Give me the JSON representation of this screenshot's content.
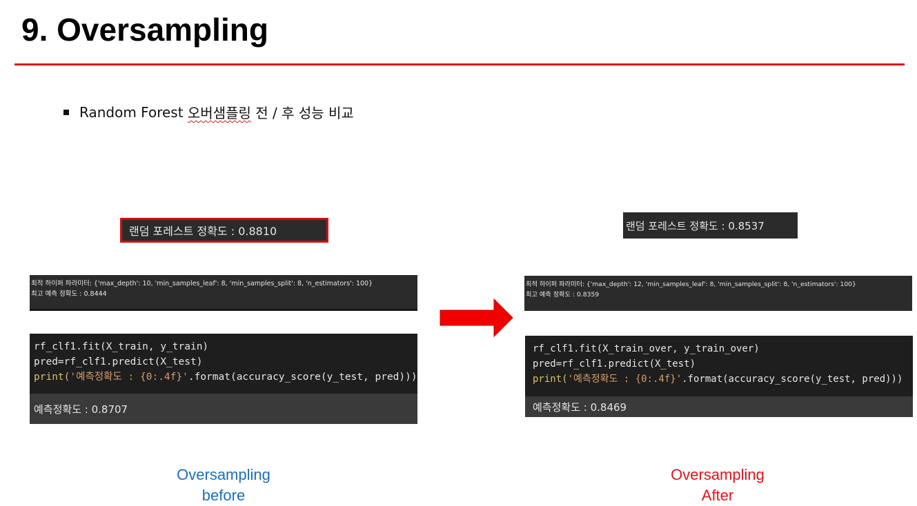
{
  "slide": {
    "title": "9. Oversampling",
    "bullet": {
      "prefix": "Random Forest ",
      "underlined": "오버샘플링",
      "suffix": " 전 / 후 성능 비교"
    }
  },
  "before": {
    "accuracy_text": "랜덤 포레스트 정확도 : 0.8810",
    "params_line1": "최적 하이퍼 파라미터:  {'max_depth': 10, 'min_samples_leaf': 8, 'min_samples_split': 8, 'n_estimators': 100}",
    "params_line2": "최고 예측 정확도 : 0.8444",
    "code_line1": "rf_clf1.fit(X_train, y_train)",
    "code_line2": "pred=rf_clf1.predict(X_test)",
    "code_line3_kw": "print(",
    "code_line3_str": "'예측정확도 : {0:.4f}'",
    "code_line3_rest": ".format(accuracy_score(y_test, pred)))",
    "output": "예측정확도 : 0.8707",
    "caption_line1": "Oversampling",
    "caption_line2": "before"
  },
  "after": {
    "accuracy_text": "랜덤 포레스트 정확도 : 0.8537",
    "params_line1": "최적 하이퍼 파라미터:  {'max_depth': 12, 'min_samples_leaf': 8, 'min_samples_split': 8, 'n_estimators': 100}",
    "params_line2": "최고 예측 정확도 : 0.8359",
    "code_line1": "rf_clf1.fit(X_train_over, y_train_over)",
    "code_line2": "pred=rf_clf1.predict(X_test)",
    "code_line3_kw": "print(",
    "code_line3_str": "'예측정확도 : {0:.4f}'",
    "code_line3_rest": ".format(accuracy_score(y_test, pred)))",
    "output": "예측정확도 : 0.8469",
    "caption_line1": "Oversampling",
    "caption_line2": "After"
  },
  "colors": {
    "accent_red": "#e0141a",
    "caption_before_blue": "#1b6fb7",
    "panel_dark": "#2b2b2b"
  },
  "icons": {
    "arrow": "right-arrow-icon",
    "bullet": "square-bullet-icon"
  }
}
